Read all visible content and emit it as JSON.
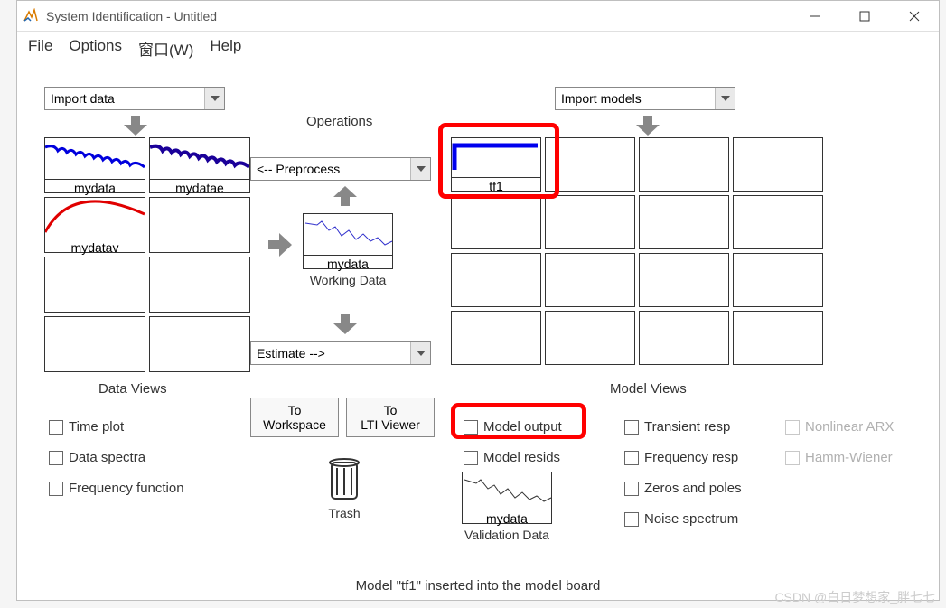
{
  "window": {
    "title": "System Identification - Untitled"
  },
  "menu": {
    "file": "File",
    "options": "Options",
    "window": "窗口(W)",
    "help": "Help"
  },
  "dropdowns": {
    "import_data": "Import data",
    "import_models": "Import models",
    "preprocess": "<-- Preprocess",
    "estimate": "Estimate -->"
  },
  "headings": {
    "operations": "Operations",
    "data_views": "Data Views",
    "model_views": "Model Views",
    "working_data": "Working Data",
    "validation_data": "Validation Data",
    "trash": "Trash"
  },
  "data_slots": [
    {
      "label": "mydata",
      "type": "blue-noisy"
    },
    {
      "label": "mydatae",
      "type": "darkblue-noisy"
    },
    {
      "label": "mydatav",
      "type": "red-arc"
    },
    {
      "label": "",
      "type": "empty"
    },
    {
      "label": "",
      "type": "empty"
    },
    {
      "label": "",
      "type": "empty"
    },
    {
      "label": "",
      "type": "empty"
    },
    {
      "label": "",
      "type": "empty"
    }
  ],
  "model_slots": [
    {
      "label": "tf1",
      "type": "blue-step"
    },
    {
      "label": "",
      "type": "empty"
    },
    {
      "label": "",
      "type": "empty"
    },
    {
      "label": "",
      "type": "empty"
    },
    {
      "label": "",
      "type": "empty"
    },
    {
      "label": "",
      "type": "empty"
    },
    {
      "label": "",
      "type": "empty"
    },
    {
      "label": "",
      "type": "empty"
    },
    {
      "label": "",
      "type": "empty"
    },
    {
      "label": "",
      "type": "empty"
    },
    {
      "label": "",
      "type": "empty"
    },
    {
      "label": "",
      "type": "empty"
    },
    {
      "label": "",
      "type": "empty"
    },
    {
      "label": "",
      "type": "empty"
    },
    {
      "label": "",
      "type": "empty"
    },
    {
      "label": "",
      "type": "empty"
    }
  ],
  "working_data": {
    "label": "mydata"
  },
  "validation_data": {
    "label": "mydata"
  },
  "buttons": {
    "to_workspace": "To\nWorkspace",
    "to_lti": "To\nLTI Viewer"
  },
  "checkboxes": {
    "time_plot": "Time plot",
    "data_spectra": "Data spectra",
    "freq_func": "Frequency function",
    "model_output": "Model output",
    "model_resids": "Model resids",
    "transient": "Transient resp",
    "freq_resp": "Frequency resp",
    "zeros_poles": "Zeros and poles",
    "noise_spec": "Noise spectrum",
    "nonlinear_arx": "Nonlinear ARX",
    "hamm_wiener": "Hamm-Wiener"
  },
  "status": "Model \"tf1\" inserted into the model board",
  "watermark": "CSDN @白日梦想家_胖七七"
}
